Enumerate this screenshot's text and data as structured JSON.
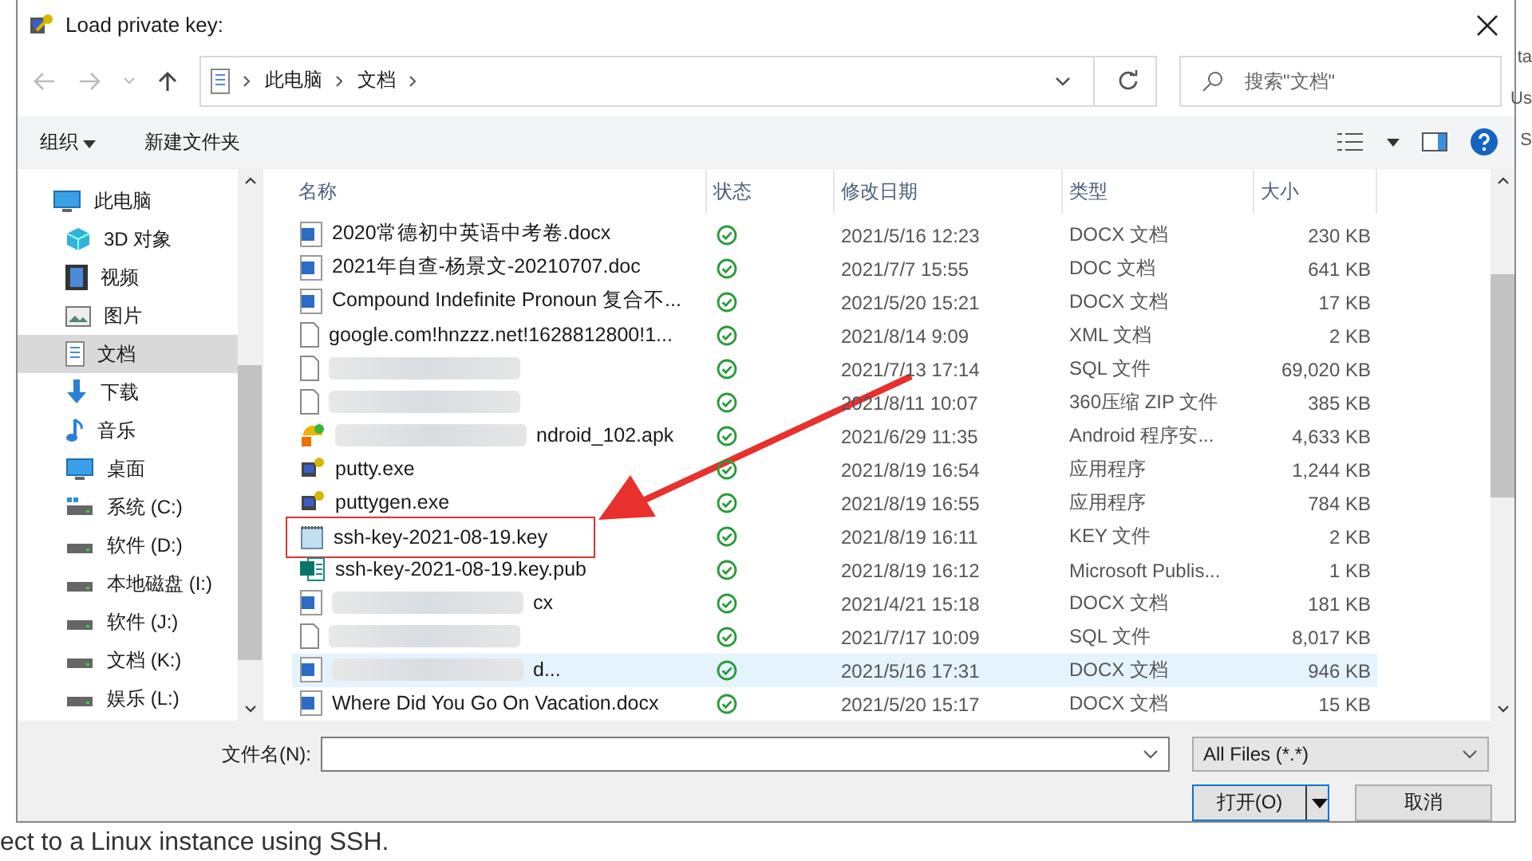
{
  "background_page": {
    "text": "ect to a Linux instance using SSH.",
    "side_texts": [
      "ta",
      "Us",
      "S"
    ]
  },
  "window": {
    "title": "Load private key:"
  },
  "address_bar": {
    "path": [
      "此电脑",
      "文档"
    ]
  },
  "search": {
    "placeholder": "搜索\"文档\""
  },
  "toolbar": {
    "organize": "组织",
    "new_folder": "新建文件夹"
  },
  "sidebar": {
    "items": [
      {
        "label": "此电脑",
        "kind": "pc",
        "selected": false,
        "children": [
          {
            "label": "3D 对象",
            "kind": "cube",
            "selected": false
          },
          {
            "label": "视频",
            "kind": "video",
            "selected": false
          },
          {
            "label": "图片",
            "kind": "picture",
            "selected": false
          },
          {
            "label": "文档",
            "kind": "document",
            "selected": true
          },
          {
            "label": "下载",
            "kind": "download",
            "selected": false
          },
          {
            "label": "音乐",
            "kind": "music",
            "selected": false
          },
          {
            "label": "桌面",
            "kind": "desktop",
            "selected": false
          },
          {
            "label": "系统 (C:)",
            "kind": "system-drive",
            "selected": false
          },
          {
            "label": "软件 (D:)",
            "kind": "drive",
            "selected": false
          },
          {
            "label": "本地磁盘 (I:)",
            "kind": "drive",
            "selected": false
          },
          {
            "label": "软件 (J:)",
            "kind": "drive",
            "selected": false
          },
          {
            "label": "文档 (K:)",
            "kind": "drive",
            "selected": false
          },
          {
            "label": "娱乐 (L:)",
            "kind": "drive",
            "selected": false
          }
        ]
      }
    ]
  },
  "table": {
    "columns": [
      "名称",
      "状态",
      "修改日期",
      "类型",
      "大小"
    ],
    "rows": [
      {
        "kind": "word",
        "name": "2020常德初中英语中考卷.docx",
        "blurred": false,
        "date": "2021/5/16 12:23",
        "type": "DOCX 文档",
        "size": "230 KB",
        "selected": false,
        "highlighted": false
      },
      {
        "kind": "word",
        "name": "2021年自查-杨景文-20210707.doc",
        "blurred": false,
        "date": "2021/7/7 15:55",
        "type": "DOC 文档",
        "size": "641 KB",
        "selected": false,
        "highlighted": false
      },
      {
        "kind": "word",
        "name": "Compound Indefinite Pronoun 复合不...",
        "blurred": false,
        "date": "2021/5/20 15:21",
        "type": "DOCX 文档",
        "size": "17 KB",
        "selected": false,
        "highlighted": false
      },
      {
        "kind": "blank",
        "name": "google.com!hnzzz.net!1628812800!1...",
        "blurred": false,
        "date": "2021/8/14 9:09",
        "type": "XML 文档",
        "size": "2 KB",
        "selected": false,
        "highlighted": false
      },
      {
        "kind": "blank",
        "name": "",
        "blurred": true,
        "date": "2021/7/13 17:14",
        "type": "SQL 文件",
        "size": "69,020 KB",
        "selected": false,
        "highlighted": false
      },
      {
        "kind": "blank",
        "name": "",
        "blurred": true,
        "date": "2021/8/11 10:07",
        "type": "360压缩 ZIP 文件",
        "size": "385 KB",
        "selected": false,
        "highlighted": false
      },
      {
        "kind": "apk",
        "name": "ndroid_102.apk",
        "blurred": true,
        "date": "2021/6/29 11:35",
        "type": "Android 程序安...",
        "size": "4,633 KB",
        "selected": false,
        "highlighted": false
      },
      {
        "kind": "exe",
        "name": "putty.exe",
        "blurred": false,
        "date": "2021/8/19 16:54",
        "type": "应用程序",
        "size": "1,244 KB",
        "selected": false,
        "highlighted": false
      },
      {
        "kind": "exe",
        "name": "puttygen.exe",
        "blurred": false,
        "date": "2021/8/19 16:55",
        "type": "应用程序",
        "size": "784 KB",
        "selected": false,
        "highlighted": false
      },
      {
        "kind": "key",
        "name": "ssh-key-2021-08-19.key",
        "blurred": false,
        "date": "2021/8/19 16:11",
        "type": "KEY 文件",
        "size": "2 KB",
        "selected": false,
        "highlighted": true
      },
      {
        "kind": "pub",
        "name": "ssh-key-2021-08-19.key.pub",
        "blurred": false,
        "date": "2021/8/19 16:12",
        "type": "Microsoft Publis...",
        "size": "1 KB",
        "selected": false,
        "highlighted": false
      },
      {
        "kind": "word",
        "name": "cx",
        "blurred": true,
        "date": "2021/4/21 15:18",
        "type": "DOCX 文档",
        "size": "181 KB",
        "selected": false,
        "highlighted": false
      },
      {
        "kind": "blank",
        "name": "",
        "blurred": true,
        "date": "2021/7/17 10:09",
        "type": "SQL 文件",
        "size": "8,017 KB",
        "selected": false,
        "highlighted": false
      },
      {
        "kind": "word",
        "name": "d...",
        "blurred": true,
        "date": "2021/5/16 17:31",
        "type": "DOCX 文档",
        "size": "946 KB",
        "selected": true,
        "highlighted": false
      },
      {
        "kind": "word",
        "name": "Where Did You Go On Vacation.docx",
        "blurred": false,
        "date": "2021/5/20 15:17",
        "type": "DOCX 文档",
        "size": "15 KB",
        "selected": false,
        "highlighted": false
      }
    ]
  },
  "footer": {
    "filename_label": "文件名(N):",
    "filter": "All Files (*.*)",
    "open": "打开(O)",
    "cancel": "取消"
  }
}
